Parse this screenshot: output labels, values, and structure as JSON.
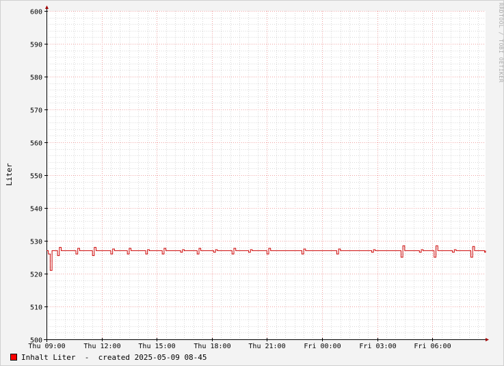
{
  "chart_data": {
    "type": "line",
    "title": "",
    "xlabel": "",
    "ylabel": "Liter",
    "ylim": [
      500,
      600
    ],
    "y_ticks": [
      "500",
      "510",
      "520",
      "530",
      "540",
      "550",
      "560",
      "570",
      "580",
      "590",
      "600"
    ],
    "x_ticks": [
      "Thu 09:00",
      "Thu 12:00",
      "Thu 15:00",
      "Thu 18:00",
      "Thu 21:00",
      "Fri 00:00",
      "Fri 03:00",
      "Fri 06:00"
    ],
    "x_range_hours": [
      9.0,
      32.9
    ],
    "grid": true,
    "legend_position": "bottom-left",
    "series": [
      {
        "name": "Inhalt Liter",
        "color": "#cc0000",
        "points": [
          [
            9.0,
            527
          ],
          [
            9.1,
            526
          ],
          [
            9.2,
            521
          ],
          [
            9.3,
            527
          ],
          [
            9.5,
            527
          ],
          [
            9.6,
            525.5
          ],
          [
            9.7,
            528
          ],
          [
            9.8,
            527
          ],
          [
            10.5,
            527
          ],
          [
            10.6,
            526
          ],
          [
            10.7,
            527.7
          ],
          [
            10.8,
            527
          ],
          [
            11.4,
            527
          ],
          [
            11.5,
            525.5
          ],
          [
            11.6,
            528
          ],
          [
            11.7,
            527
          ],
          [
            12.4,
            527
          ],
          [
            12.5,
            526
          ],
          [
            12.6,
            527.5
          ],
          [
            12.7,
            527
          ],
          [
            13.3,
            527
          ],
          [
            13.4,
            526
          ],
          [
            13.5,
            527.7
          ],
          [
            13.6,
            527
          ],
          [
            14.3,
            527
          ],
          [
            14.4,
            526
          ],
          [
            14.5,
            527.3
          ],
          [
            14.6,
            527
          ],
          [
            15.2,
            527
          ],
          [
            15.3,
            526
          ],
          [
            15.4,
            527.7
          ],
          [
            15.5,
            527
          ],
          [
            16.2,
            527
          ],
          [
            16.3,
            526.5
          ],
          [
            16.4,
            527.3
          ],
          [
            16.5,
            527
          ],
          [
            17.1,
            527
          ],
          [
            17.2,
            526
          ],
          [
            17.3,
            527.7
          ],
          [
            17.4,
            527
          ],
          [
            18.0,
            527
          ],
          [
            18.1,
            526.5
          ],
          [
            18.2,
            527.3
          ],
          [
            18.3,
            527
          ],
          [
            19.0,
            527
          ],
          [
            19.1,
            526
          ],
          [
            19.2,
            527.7
          ],
          [
            19.3,
            527
          ],
          [
            19.9,
            527
          ],
          [
            20.0,
            526.5
          ],
          [
            20.1,
            527.3
          ],
          [
            20.2,
            527
          ],
          [
            20.9,
            527
          ],
          [
            21.0,
            526
          ],
          [
            21.1,
            527.7
          ],
          [
            21.2,
            527
          ],
          [
            22.8,
            527
          ],
          [
            22.9,
            526
          ],
          [
            23.0,
            527.5
          ],
          [
            23.1,
            527
          ],
          [
            24.7,
            527
          ],
          [
            24.8,
            526
          ],
          [
            24.9,
            527.5
          ],
          [
            25.0,
            527
          ],
          [
            26.6,
            527
          ],
          [
            26.7,
            526.5
          ],
          [
            26.8,
            527.3
          ],
          [
            26.9,
            527
          ],
          [
            28.2,
            527
          ],
          [
            28.3,
            525
          ],
          [
            28.4,
            528.5
          ],
          [
            28.5,
            527
          ],
          [
            29.2,
            527
          ],
          [
            29.3,
            526.5
          ],
          [
            29.4,
            527.3
          ],
          [
            29.5,
            527
          ],
          [
            30.0,
            527
          ],
          [
            30.1,
            525
          ],
          [
            30.2,
            528.5
          ],
          [
            30.3,
            527
          ],
          [
            31.0,
            527
          ],
          [
            31.1,
            526.5
          ],
          [
            31.2,
            527.3
          ],
          [
            31.3,
            527
          ],
          [
            32.0,
            527
          ],
          [
            32.1,
            525
          ],
          [
            32.2,
            528.3
          ],
          [
            32.3,
            527
          ],
          [
            32.8,
            527
          ],
          [
            32.85,
            526.5
          ],
          [
            32.9,
            527
          ]
        ]
      }
    ]
  },
  "legend": {
    "series_label": "Inhalt Liter",
    "separator": "-",
    "created_text": "created 2025-05-09 08-45"
  },
  "watermark": "RRDTOOL / TOBI OETIKER"
}
